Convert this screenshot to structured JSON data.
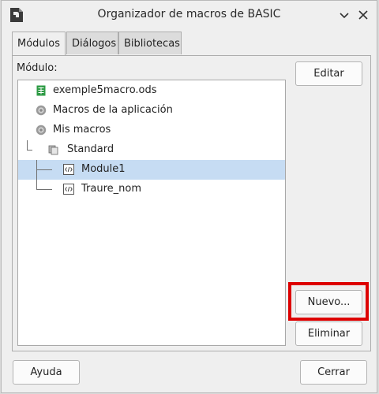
{
  "window": {
    "title": "Organizador de macros de BASIC"
  },
  "tabs": [
    {
      "label": "Módulos",
      "active": true
    },
    {
      "label": "Diálogos",
      "active": false
    },
    {
      "label": "Bibliotecas",
      "active": false
    }
  ],
  "panel": {
    "module_label": "Módulo:"
  },
  "tree": {
    "items": [
      {
        "label": "exemple5macro.ods",
        "icon": "spreadsheet-icon"
      },
      {
        "label": "Macros de la aplicación",
        "icon": "macro-library-icon"
      },
      {
        "label": "Mis macros",
        "icon": "macro-library-icon"
      },
      {
        "label": "Standard",
        "icon": "library-icon"
      },
      {
        "label": "Module1",
        "icon": "module-icon",
        "selected": true
      },
      {
        "label": "Traure_nom",
        "icon": "module-icon"
      }
    ]
  },
  "buttons": {
    "editar": "Editar",
    "nuevo": "Nuevo...",
    "eliminar": "Eliminar",
    "ayuda": "Ayuda",
    "cerrar": "Cerrar"
  },
  "colors": {
    "selection": "#c6dcf3",
    "highlight_border": "#dd0000",
    "spreadsheet_green": "#2e9b45"
  }
}
